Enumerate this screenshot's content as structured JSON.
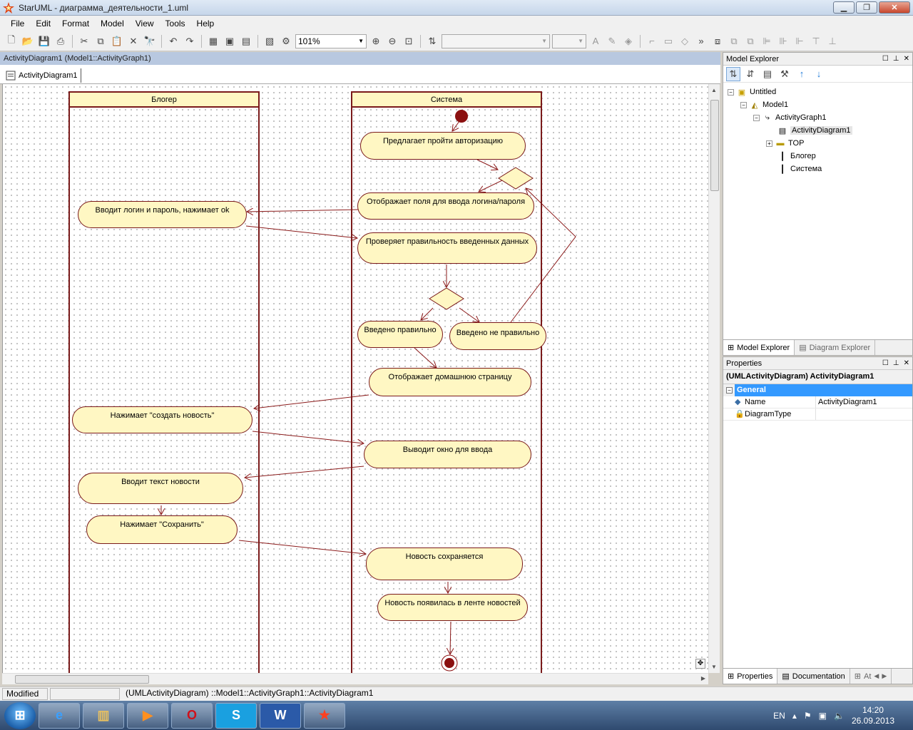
{
  "window": {
    "title": "StarUML - диаграмма_деятельности_1.uml",
    "controls": [
      "▁",
      "❐",
      "✕"
    ]
  },
  "menu": [
    "File",
    "Edit",
    "Format",
    "Model",
    "View",
    "Tools",
    "Help"
  ],
  "toolbar": {
    "zoom": "101%"
  },
  "diagram_panel": {
    "header": "ActivityDiagram1 (Model1::ActivityGraph1)",
    "tab_label": "ActivityDiagram1"
  },
  "diagram": {
    "lanes": {
      "blogger": "Блогер",
      "system": "Система"
    },
    "activities": {
      "a1": "Предлагает пройти авторизацию",
      "a2": "Отображает поля для ввода логина/пароля",
      "a3": "Вводит логин и пароль, нажимает ok",
      "a4": "Проверяет правильность введенных данных",
      "a5": "Введено правильно",
      "a6": "Введено не правильно",
      "a7": "Отображает домашнюю страницу",
      "a8": "Нажимает \"создать новость\"",
      "a9": "Выводит окно для ввода",
      "a10": "Вводит текст новости",
      "a11": "Нажимает \"Сохранить\"",
      "a12": "Новость сохраняется",
      "a13": "Новость появилась в ленте новостей"
    },
    "colors": {
      "fill": "#fff7c3",
      "stroke": "#7a1a1a",
      "edge": "#8b1a1a",
      "node": "#8b1010"
    }
  },
  "model_explorer": {
    "title": "Model Explorer",
    "tree": [
      "Untitled",
      "Model1",
      "ActivityGraph1",
      "ActivityDiagram1",
      "TOP",
      "Блогер",
      "Система"
    ],
    "tabs": [
      "Model Explorer",
      "Diagram Explorer"
    ]
  },
  "properties": {
    "title": "Properties",
    "heading": "(UMLActivityDiagram) ActivityDiagram1",
    "category": "General",
    "rows": [
      {
        "name": "Name",
        "value": "ActivityDiagram1"
      },
      {
        "name": "DiagramType",
        "value": ""
      }
    ],
    "tabs": [
      "Properties",
      "Documentation",
      "At"
    ]
  },
  "status": {
    "state": "Modified",
    "path": "(UMLActivityDiagram) ::Model1::ActivityGraph1::ActivityDiagram1"
  },
  "taskbar": {
    "lang": "EN",
    "time": "14:20",
    "date": "26.09.2013"
  }
}
